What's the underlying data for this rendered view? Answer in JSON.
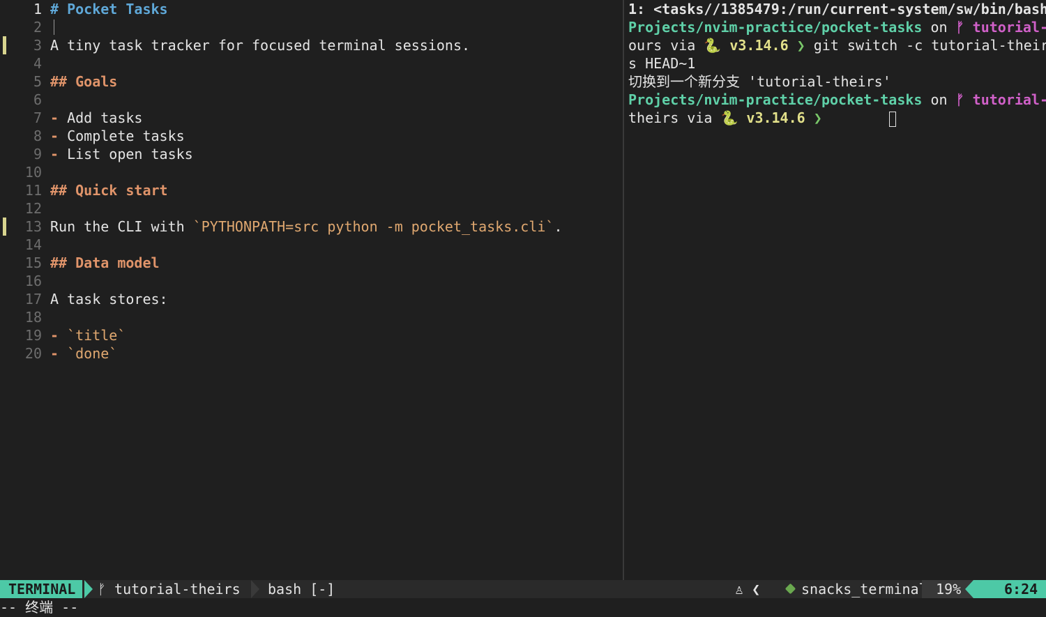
{
  "editor": {
    "lines": [
      {
        "n": "1",
        "parts": [
          {
            "t": "# ",
            "c": "h-mark"
          },
          {
            "t": "Pocket Tasks",
            "c": "h1"
          }
        ],
        "current": true
      },
      {
        "n": "2",
        "parts": []
      },
      {
        "n": "3",
        "parts": [
          {
            "t": "A tiny task tracker for focused terminal sessions.",
            "c": ""
          }
        ],
        "sign": true
      },
      {
        "n": "4",
        "parts": []
      },
      {
        "n": "5",
        "parts": [
          {
            "t": "## Goals",
            "c": "h2"
          }
        ]
      },
      {
        "n": "6",
        "parts": []
      },
      {
        "n": "7",
        "parts": [
          {
            "t": "- ",
            "c": "h2"
          },
          {
            "t": "Add tasks",
            "c": ""
          }
        ]
      },
      {
        "n": "8",
        "parts": [
          {
            "t": "- ",
            "c": "h2"
          },
          {
            "t": "Complete tasks",
            "c": ""
          }
        ]
      },
      {
        "n": "9",
        "parts": [
          {
            "t": "- ",
            "c": "h2"
          },
          {
            "t": "List open tasks",
            "c": ""
          }
        ]
      },
      {
        "n": "10",
        "parts": []
      },
      {
        "n": "11",
        "parts": [
          {
            "t": "## Quick start",
            "c": "h2"
          }
        ]
      },
      {
        "n": "12",
        "parts": []
      },
      {
        "n": "13",
        "parts": [
          {
            "t": "Run the CLI with ",
            "c": ""
          },
          {
            "t": "`PYTHONPATH=src python -m pocket_tasks.cli`",
            "c": "code"
          },
          {
            "t": ".",
            "c": ""
          }
        ],
        "sign": true
      },
      {
        "n": "14",
        "parts": []
      },
      {
        "n": "15",
        "parts": [
          {
            "t": "## Data model",
            "c": "h2"
          }
        ]
      },
      {
        "n": "16",
        "parts": []
      },
      {
        "n": "17",
        "parts": [
          {
            "t": "A task stores:",
            "c": ""
          }
        ]
      },
      {
        "n": "18",
        "parts": []
      },
      {
        "n": "19",
        "parts": [
          {
            "t": "- ",
            "c": "h2"
          },
          {
            "t": "`title`",
            "c": "code"
          }
        ]
      },
      {
        "n": "20",
        "parts": [
          {
            "t": "- ",
            "c": "h2"
          },
          {
            "t": "`done`",
            "c": "code"
          }
        ]
      }
    ]
  },
  "terminal": {
    "title": "1: <tasks//1385479:/run/current-system/sw/bin/bash",
    "lines": [
      [
        {
          "t": "Projects/nvim-practice/pocket-tasks",
          "c": "path"
        },
        {
          "t": " on ",
          "c": ""
        },
        {
          "t": "ᚠ tutorial-",
          "c": "branch"
        }
      ],
      [
        {
          "t": "ours via ",
          "c": ""
        },
        {
          "t": "🐍 v3.14.6",
          "c": "ver"
        },
        {
          "t": " ❯ ",
          "c": "arrow-ok"
        },
        {
          "t": "git switch -c tutorial-their",
          "c": ""
        }
      ],
      [
        {
          "t": "s HEAD~1",
          "c": ""
        }
      ],
      [
        {
          "t": "切换到一个新分支 'tutorial-theirs'",
          "c": ""
        }
      ],
      [
        {
          "t": "Projects/nvim-practice/pocket-tasks",
          "c": "path"
        },
        {
          "t": " on ",
          "c": ""
        },
        {
          "t": "ᚠ tutorial-",
          "c": "branch"
        }
      ],
      [
        {
          "t": "theirs via ",
          "c": ""
        },
        {
          "t": "🐍 v3.14.6",
          "c": "ver"
        },
        {
          "t": " ❯",
          "c": "arrow-ok"
        },
        {
          "t": "        ",
          "c": ""
        },
        {
          "cursor": true
        }
      ]
    ]
  },
  "statusline": {
    "mode": "TERMINAL",
    "branch": "ᚠ tutorial-theirs",
    "file": "bash [-]",
    "icons": "♙ ❮",
    "filetype": "snacks_terminal",
    "percent": "19%",
    "position": "6:24"
  },
  "message": "-- 终端 --",
  "colors": {
    "accent": "#4dc9a6",
    "heading1": "#5fa8d8",
    "heading2": "#e0946a",
    "code": "#e0a870",
    "path": "#5fd0a8",
    "branch": "#d060c8",
    "version": "#e2e08a",
    "git_sign": "#d8d48e"
  }
}
